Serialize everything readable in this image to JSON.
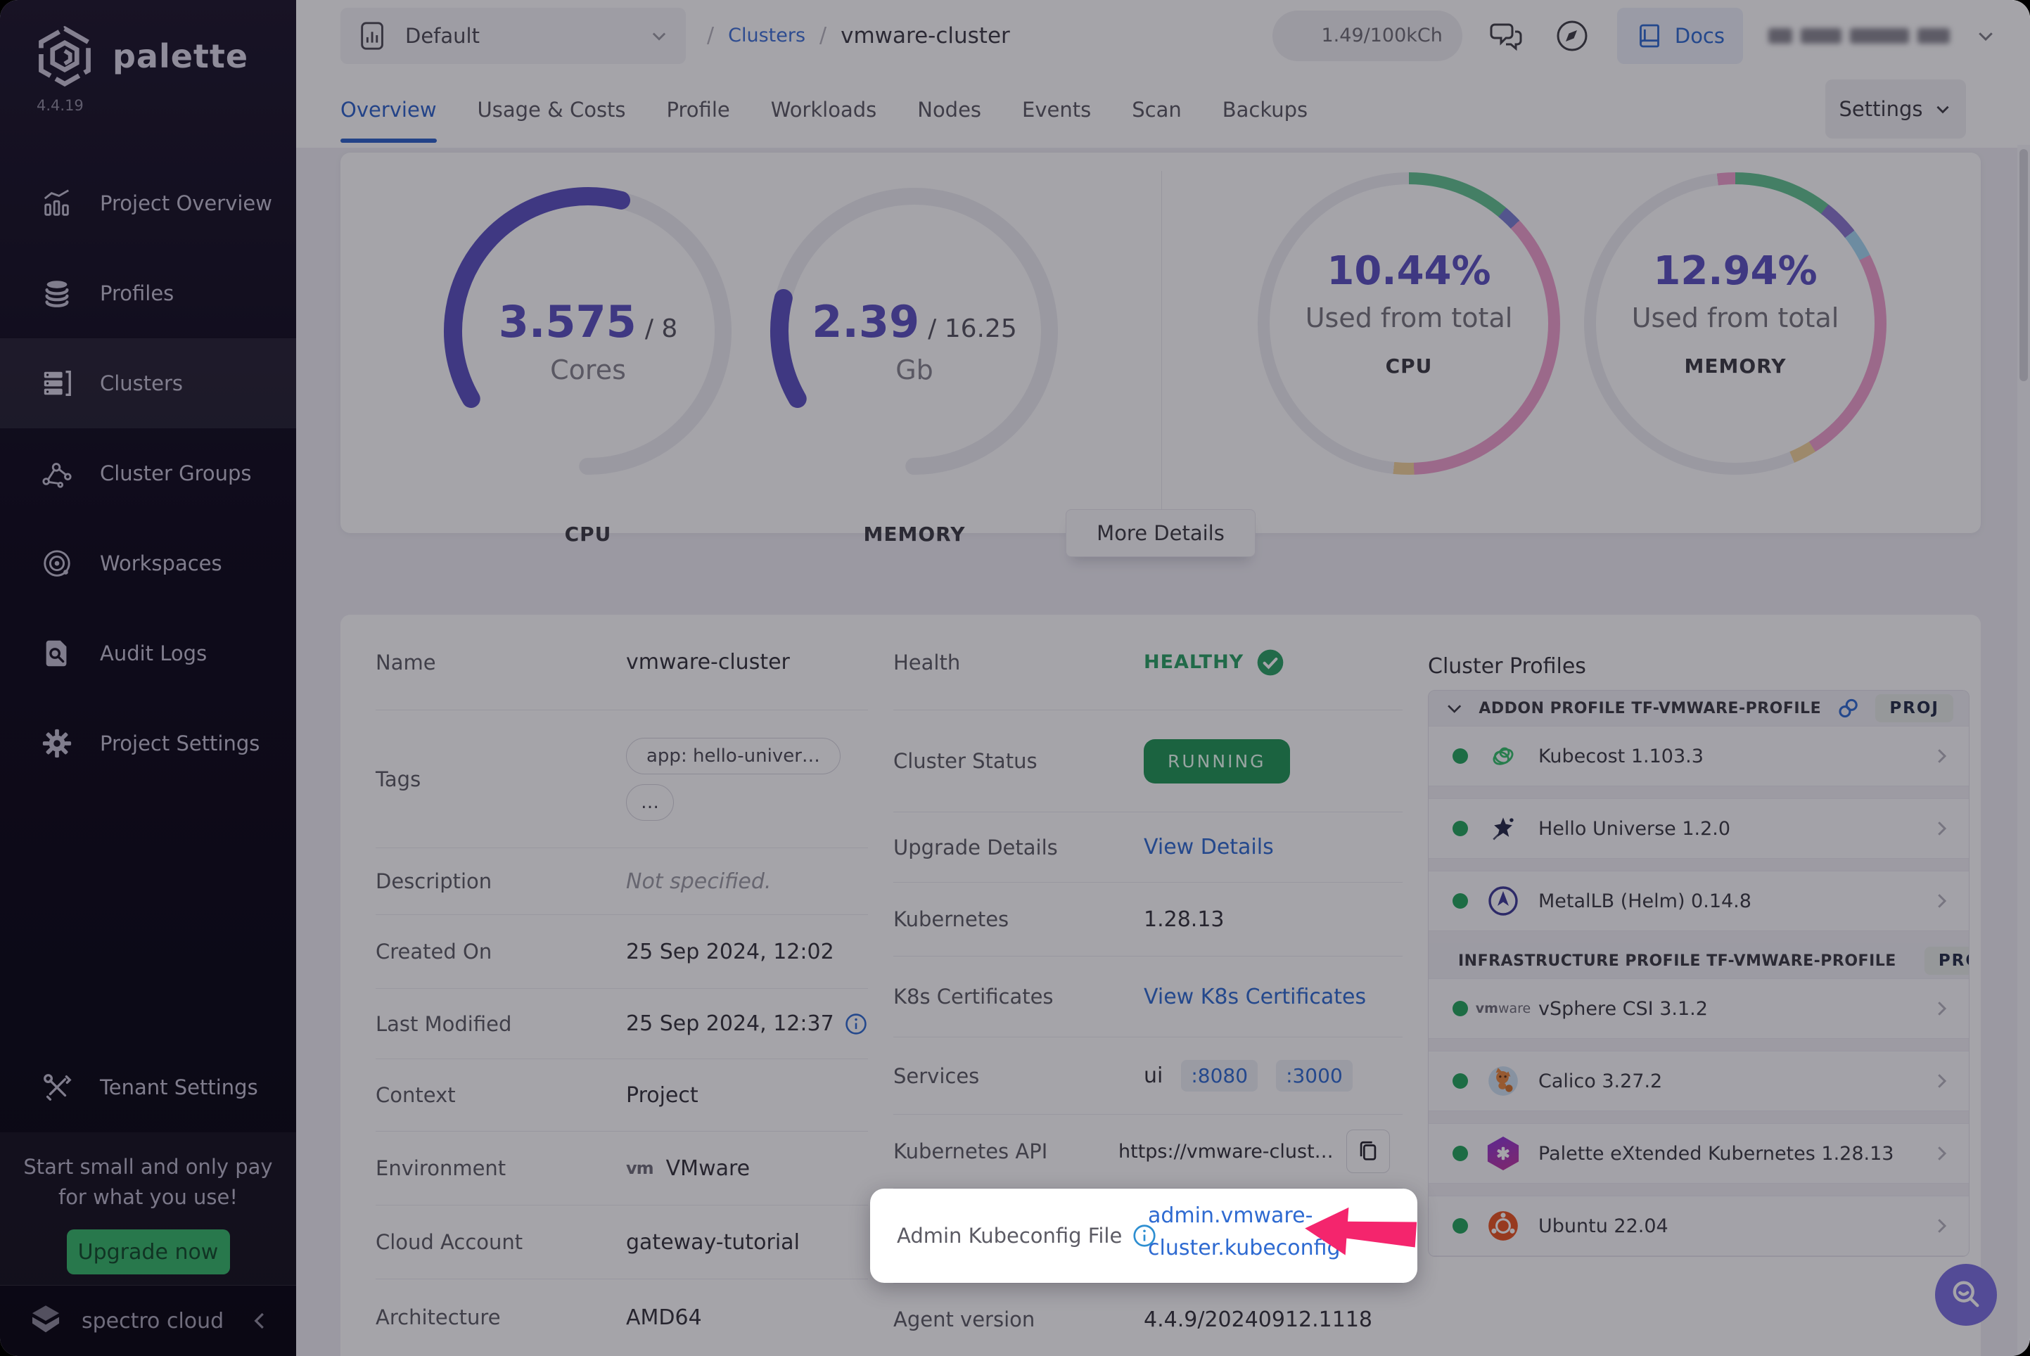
{
  "app": {
    "logo_text": "palette",
    "version": "4.4.19"
  },
  "sidebar": {
    "items": [
      {
        "label": "Project Overview"
      },
      {
        "label": "Profiles"
      },
      {
        "label": "Clusters",
        "active": true
      },
      {
        "label": "Cluster Groups"
      },
      {
        "label": "Workspaces"
      },
      {
        "label": "Audit Logs"
      },
      {
        "label": "Project Settings"
      }
    ],
    "tenant_settings_label": "Tenant Settings",
    "promo": {
      "line1": "Start small and only pay",
      "line2": "for what you use!",
      "button_label": "Upgrade now"
    },
    "footer_brand": "spectro cloud"
  },
  "topbar": {
    "project_selector_value": "Default",
    "breadcrumb": {
      "separator": "/",
      "parent": "Clusters",
      "current": "vmware-cluster"
    },
    "usage_badge": "1.49/100kCh",
    "docs_label": "Docs"
  },
  "tabs": {
    "items": [
      "Overview",
      "Usage & Costs",
      "Profile",
      "Workloads",
      "Nodes",
      "Events",
      "Scan",
      "Backups"
    ],
    "active": "Overview",
    "settings_label": "Settings"
  },
  "stats": {
    "more_details_label": "More Details",
    "gauges": [
      {
        "metric": "CPU",
        "used": 3.575,
        "total": 8,
        "used_label": "3.575",
        "total_label": "/ 8",
        "unit": "Cores"
      },
      {
        "metric": "MEMORY",
        "used": 2.39,
        "total": 16.25,
        "used_label": "2.39",
        "total_label": "/ 16.25",
        "unit": "Gb"
      }
    ],
    "donuts": [
      {
        "metric": "CPU",
        "pct_label": "10.44%",
        "caption": "Used from total",
        "segments": [
          {
            "color": "green",
            "from": 0,
            "to": 40
          },
          {
            "color": "purple",
            "from": 40,
            "to": 47
          },
          {
            "color": "pink",
            "from": 47,
            "to": 178
          },
          {
            "color": "yellow",
            "from": 178,
            "to": 186
          },
          {
            "color": "track",
            "from": 186,
            "to": 360
          }
        ]
      },
      {
        "metric": "MEMORY",
        "pct_label": "12.94%",
        "caption": "Used from total",
        "segments": [
          {
            "color": "green",
            "from": 0,
            "to": 38
          },
          {
            "color": "violet",
            "from": 38,
            "to": 52
          },
          {
            "color": "blue",
            "from": 52,
            "to": 63
          },
          {
            "color": "pink",
            "from": 63,
            "to": 148
          },
          {
            "color": "yellow",
            "from": 148,
            "to": 157
          },
          {
            "color": "track",
            "from": 157,
            "to": 353
          },
          {
            "color": "pink2",
            "from": 353,
            "to": 360
          }
        ]
      }
    ]
  },
  "details": {
    "left": [
      {
        "label": "Name",
        "value": "vmware-cluster"
      },
      {
        "label": "Tags",
        "tag_primary": "app: hello-univer…",
        "tag_more": "…"
      },
      {
        "label": "Description",
        "value": "Not specified."
      },
      {
        "label": "Created On",
        "value": "25 Sep 2024, 12:02"
      },
      {
        "label": "Last Modified",
        "value": "25 Sep 2024, 12:37"
      },
      {
        "label": "Context",
        "value": "Project"
      },
      {
        "label": "Environment",
        "value": "VMware",
        "logo_mark": "vm"
      },
      {
        "label": "Cloud Account",
        "value": "gateway-tutorial"
      },
      {
        "label": "Architecture",
        "value": "AMD64"
      }
    ],
    "middle": [
      {
        "label": "Health",
        "value": "HEALTHY"
      },
      {
        "label": "Cluster Status",
        "value": "RUNNING"
      },
      {
        "label": "Upgrade Details",
        "value": "View Details"
      },
      {
        "label": "Kubernetes",
        "value": "1.28.13"
      },
      {
        "label": "K8s Certificates",
        "value": "View K8s Certificates"
      },
      {
        "label": "Services",
        "value": "ui",
        "port_links": [
          ":8080",
          ":3000"
        ]
      },
      {
        "label": "Kubernetes API",
        "value": "https://vmware-clust…"
      },
      {
        "label": "Admin Kubeconfig File",
        "value_line1": "admin.vmware-",
        "value_line2": "cluster.kubeconfig"
      },
      {
        "label": "Agent version",
        "value": "4.4.9/20240912.1118"
      }
    ]
  },
  "profiles": {
    "title": "Cluster Profiles",
    "sections": [
      {
        "header": "ADDON PROFILE TF-VMWARE-PROFILE",
        "badge": "PROJ",
        "items": [
          {
            "name": "Kubecost 1.103.3",
            "icon": "kubecost"
          },
          {
            "name": "Hello Universe 1.2.0",
            "icon": "hello-universe"
          },
          {
            "name": "MetalLB (Helm) 0.14.8",
            "icon": "metallb"
          }
        ]
      },
      {
        "header": "INFRASTRUCTURE PROFILE TF-VMWARE-PROFILE",
        "badge": "PROJ",
        "items": [
          {
            "name": "vSphere CSI 3.1.2",
            "icon": "vmware"
          },
          {
            "name": "Calico 3.27.2",
            "icon": "calico"
          },
          {
            "name": "Palette eXtended Kubernetes 1.28.13",
            "icon": "pxk"
          },
          {
            "name": "Ubuntu 22.04",
            "icon": "ubuntu"
          }
        ]
      }
    ]
  },
  "colors": {
    "accent_purple": "#5a50c0",
    "link_blue": "#2e6ad1",
    "healthy_green": "#2aa263",
    "running_bg": "#1f9655",
    "upgrade_green": "#35b869",
    "arrow_pink": "#f4256d",
    "donut": {
      "green": "#62c491",
      "purple": "#7b7fd2",
      "violet": "#8b77cf",
      "blue": "#a5d8f2",
      "pink": "#efa0cd",
      "pink2": "#efa0cd",
      "yellow": "#f2d49b",
      "track": "#ededf2"
    }
  }
}
